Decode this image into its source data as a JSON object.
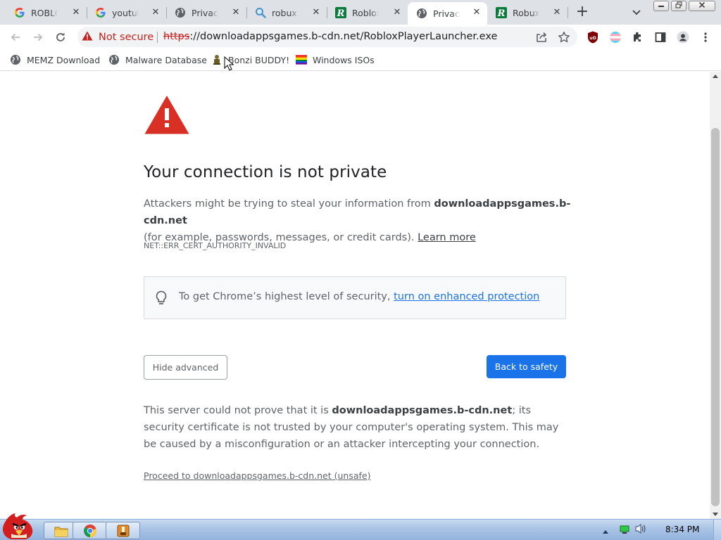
{
  "tabs": [
    {
      "title": "ROBLOX",
      "icon": "google-g-icon"
    },
    {
      "title": "youtube",
      "icon": "google-g-icon"
    },
    {
      "title": "Privacy e",
      "icon": "globe-icon"
    },
    {
      "title": "robux.ex",
      "icon": "search-magnifier-icon"
    },
    {
      "title": "RobloxPl",
      "icon": "roblox-r-icon"
    },
    {
      "title": "Privacy e",
      "icon": "globe-icon",
      "active": true
    },
    {
      "title": "Robux T",
      "icon": "roblox-r-icon"
    }
  ],
  "toolbar": {
    "security_label": "Not secure",
    "url_scheme": "https",
    "url_rest": "://downloadappsgames.b-cdn.net/RobloxPlayerLauncher.exe"
  },
  "bookmarks": [
    {
      "label": "MEMZ Download",
      "icon": "globe-icon"
    },
    {
      "label": "Malware Database",
      "icon": "globe-icon"
    },
    {
      "label": "Bonzi BUDDY!",
      "icon": "bonzi-icon"
    },
    {
      "label": "Windows ISOs",
      "icon": "rainbow-flag-icon"
    }
  ],
  "page": {
    "heading": "Your connection is not private",
    "explanation_prefix": "Attackers might be trying to steal your information from ",
    "domain": "downloadappsgames.b-cdn.net",
    "explanation_suffix": "(for example, passwords, messages, or credit cards).",
    "learn_more": "Learn more",
    "error_code": "NET::ERR_CERT_AUTHORITY_INVALID",
    "enhanced_prefix": "To get Chrome’s highest level of security,",
    "enhanced_link": "turn on enhanced protection",
    "hide_advanced": "Hide advanced",
    "back_to_safety": "Back to safety",
    "details_prefix": "This server could not prove that it is ",
    "details_domain": "downloadappsgames.b-cdn.net",
    "details_suffix": "; its security certificate is not trusted by your computer's operating system. This may be caused by a misconfiguration or an attacker intercepting your connection.",
    "proceed_link": "Proceed to downloadappsgames.b-cdn.net (unsafe)"
  },
  "taskbar": {
    "clock": "8:34 PM"
  },
  "colors": {
    "accent": "#1a73e8",
    "danger": "#c5221f",
    "warning_icon": "#d93025",
    "tab_strip": "#dee1e6"
  }
}
